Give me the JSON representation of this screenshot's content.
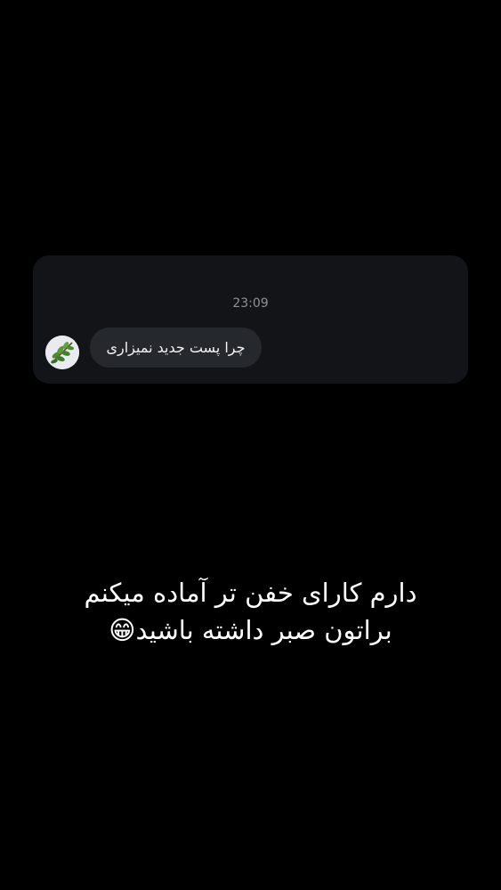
{
  "message_card": {
    "timestamp": "23:09",
    "avatar_icon": "leaf-avatar-icon",
    "message_text": "چرا پست جدید نمیزاری"
  },
  "caption": {
    "line1": "دارم کارای خفن تر آماده میکنم",
    "line2": "براتون صبر داشته باشید😁"
  },
  "colors": {
    "background": "#000000",
    "card": "#121417",
    "bubble": "#25282d",
    "timestamp": "#8e9196",
    "text": "#ffffff"
  }
}
